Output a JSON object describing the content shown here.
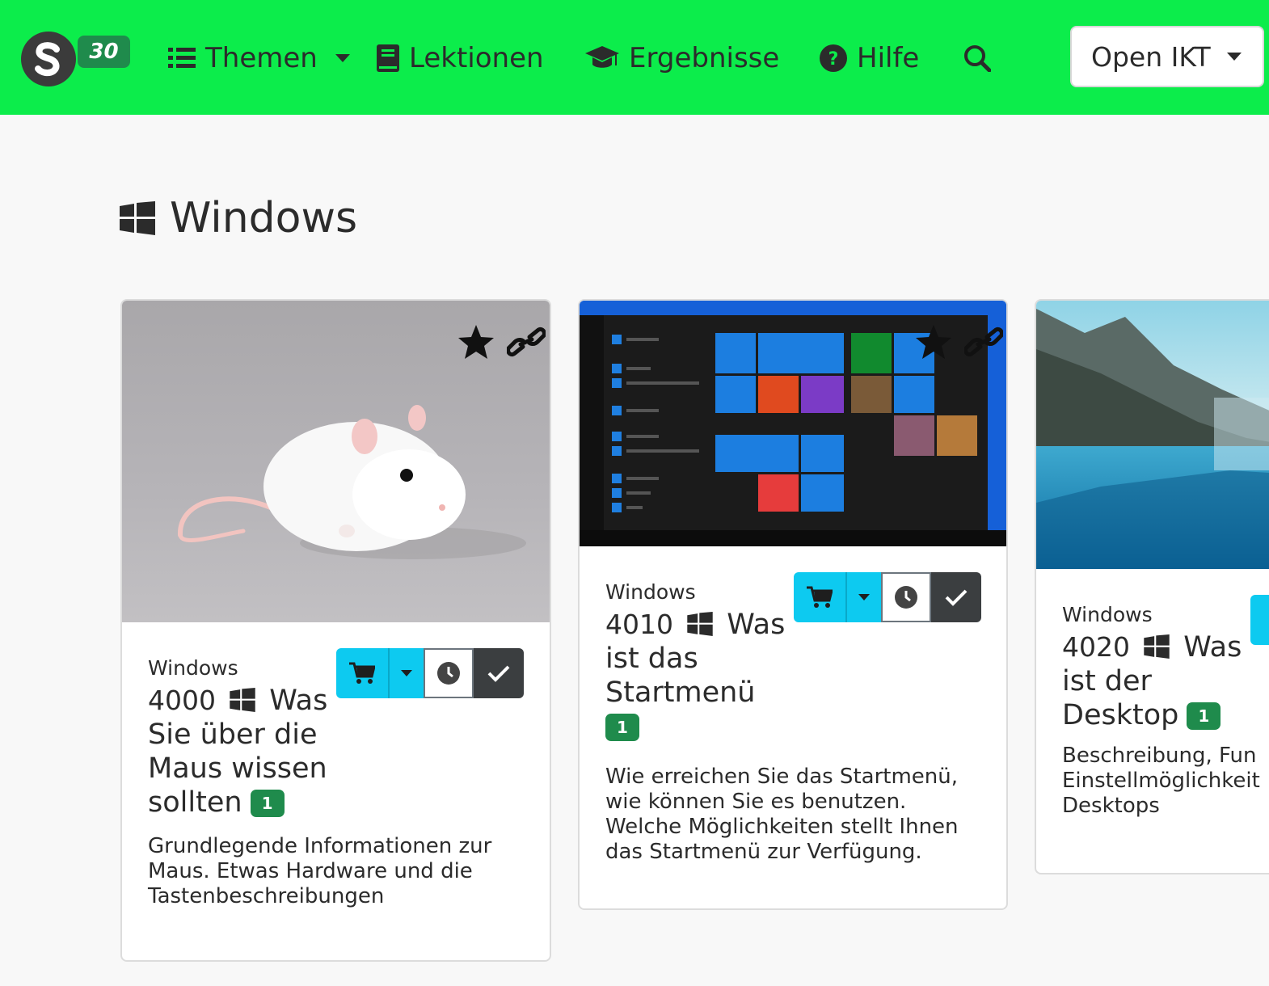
{
  "navbar": {
    "logo_badge": "30",
    "items": [
      {
        "label": "Themen"
      },
      {
        "label": "Lektionen"
      },
      {
        "label": "Ergebnisse"
      },
      {
        "label": "Hilfe"
      }
    ],
    "org_select": "Open IKT"
  },
  "page": {
    "title": "Windows"
  },
  "cards": [
    {
      "label": "Windows",
      "number": "4000",
      "title": "Was Sie über die Maus wissen sollten",
      "title_lines": [
        "Sie über die",
        "Maus wissen",
        "sollten"
      ],
      "badge": "1",
      "description_lines": [
        "Grundlegende Informationen zur",
        "Maus. Etwas Hardware und die",
        "Tastenbeschreibungen"
      ],
      "image": "white mouse toy"
    },
    {
      "label": "Windows",
      "number": "4010",
      "title": "Was ist das Startmenü",
      "title_lines": [
        "ist das",
        "Startmenü"
      ],
      "badge": "1",
      "description_lines": [
        "Wie erreichen Sie das Startmenü,",
        "wie können Sie es benutzen.",
        "Welche Möglichkeiten stellt Ihnen",
        "das Startmenü zur Verfügung."
      ],
      "image": "windows start menu screenshot"
    },
    {
      "label": "Windows",
      "number": "4020",
      "title": "Was ist der Desktop",
      "title_lines": [
        "ist der",
        "Desktop"
      ],
      "badge": "1",
      "description_lines": [
        "Beschreibung, Fun",
        "Einstellmöglichkeit",
        "Desktops"
      ],
      "image": "mountain lake desktop wallpaper"
    }
  ],
  "colors": {
    "navbar": "#0ced4b",
    "badge": "#1f8b4c",
    "info_button": "#0dcaf0",
    "dark_button": "#3b3e40"
  }
}
